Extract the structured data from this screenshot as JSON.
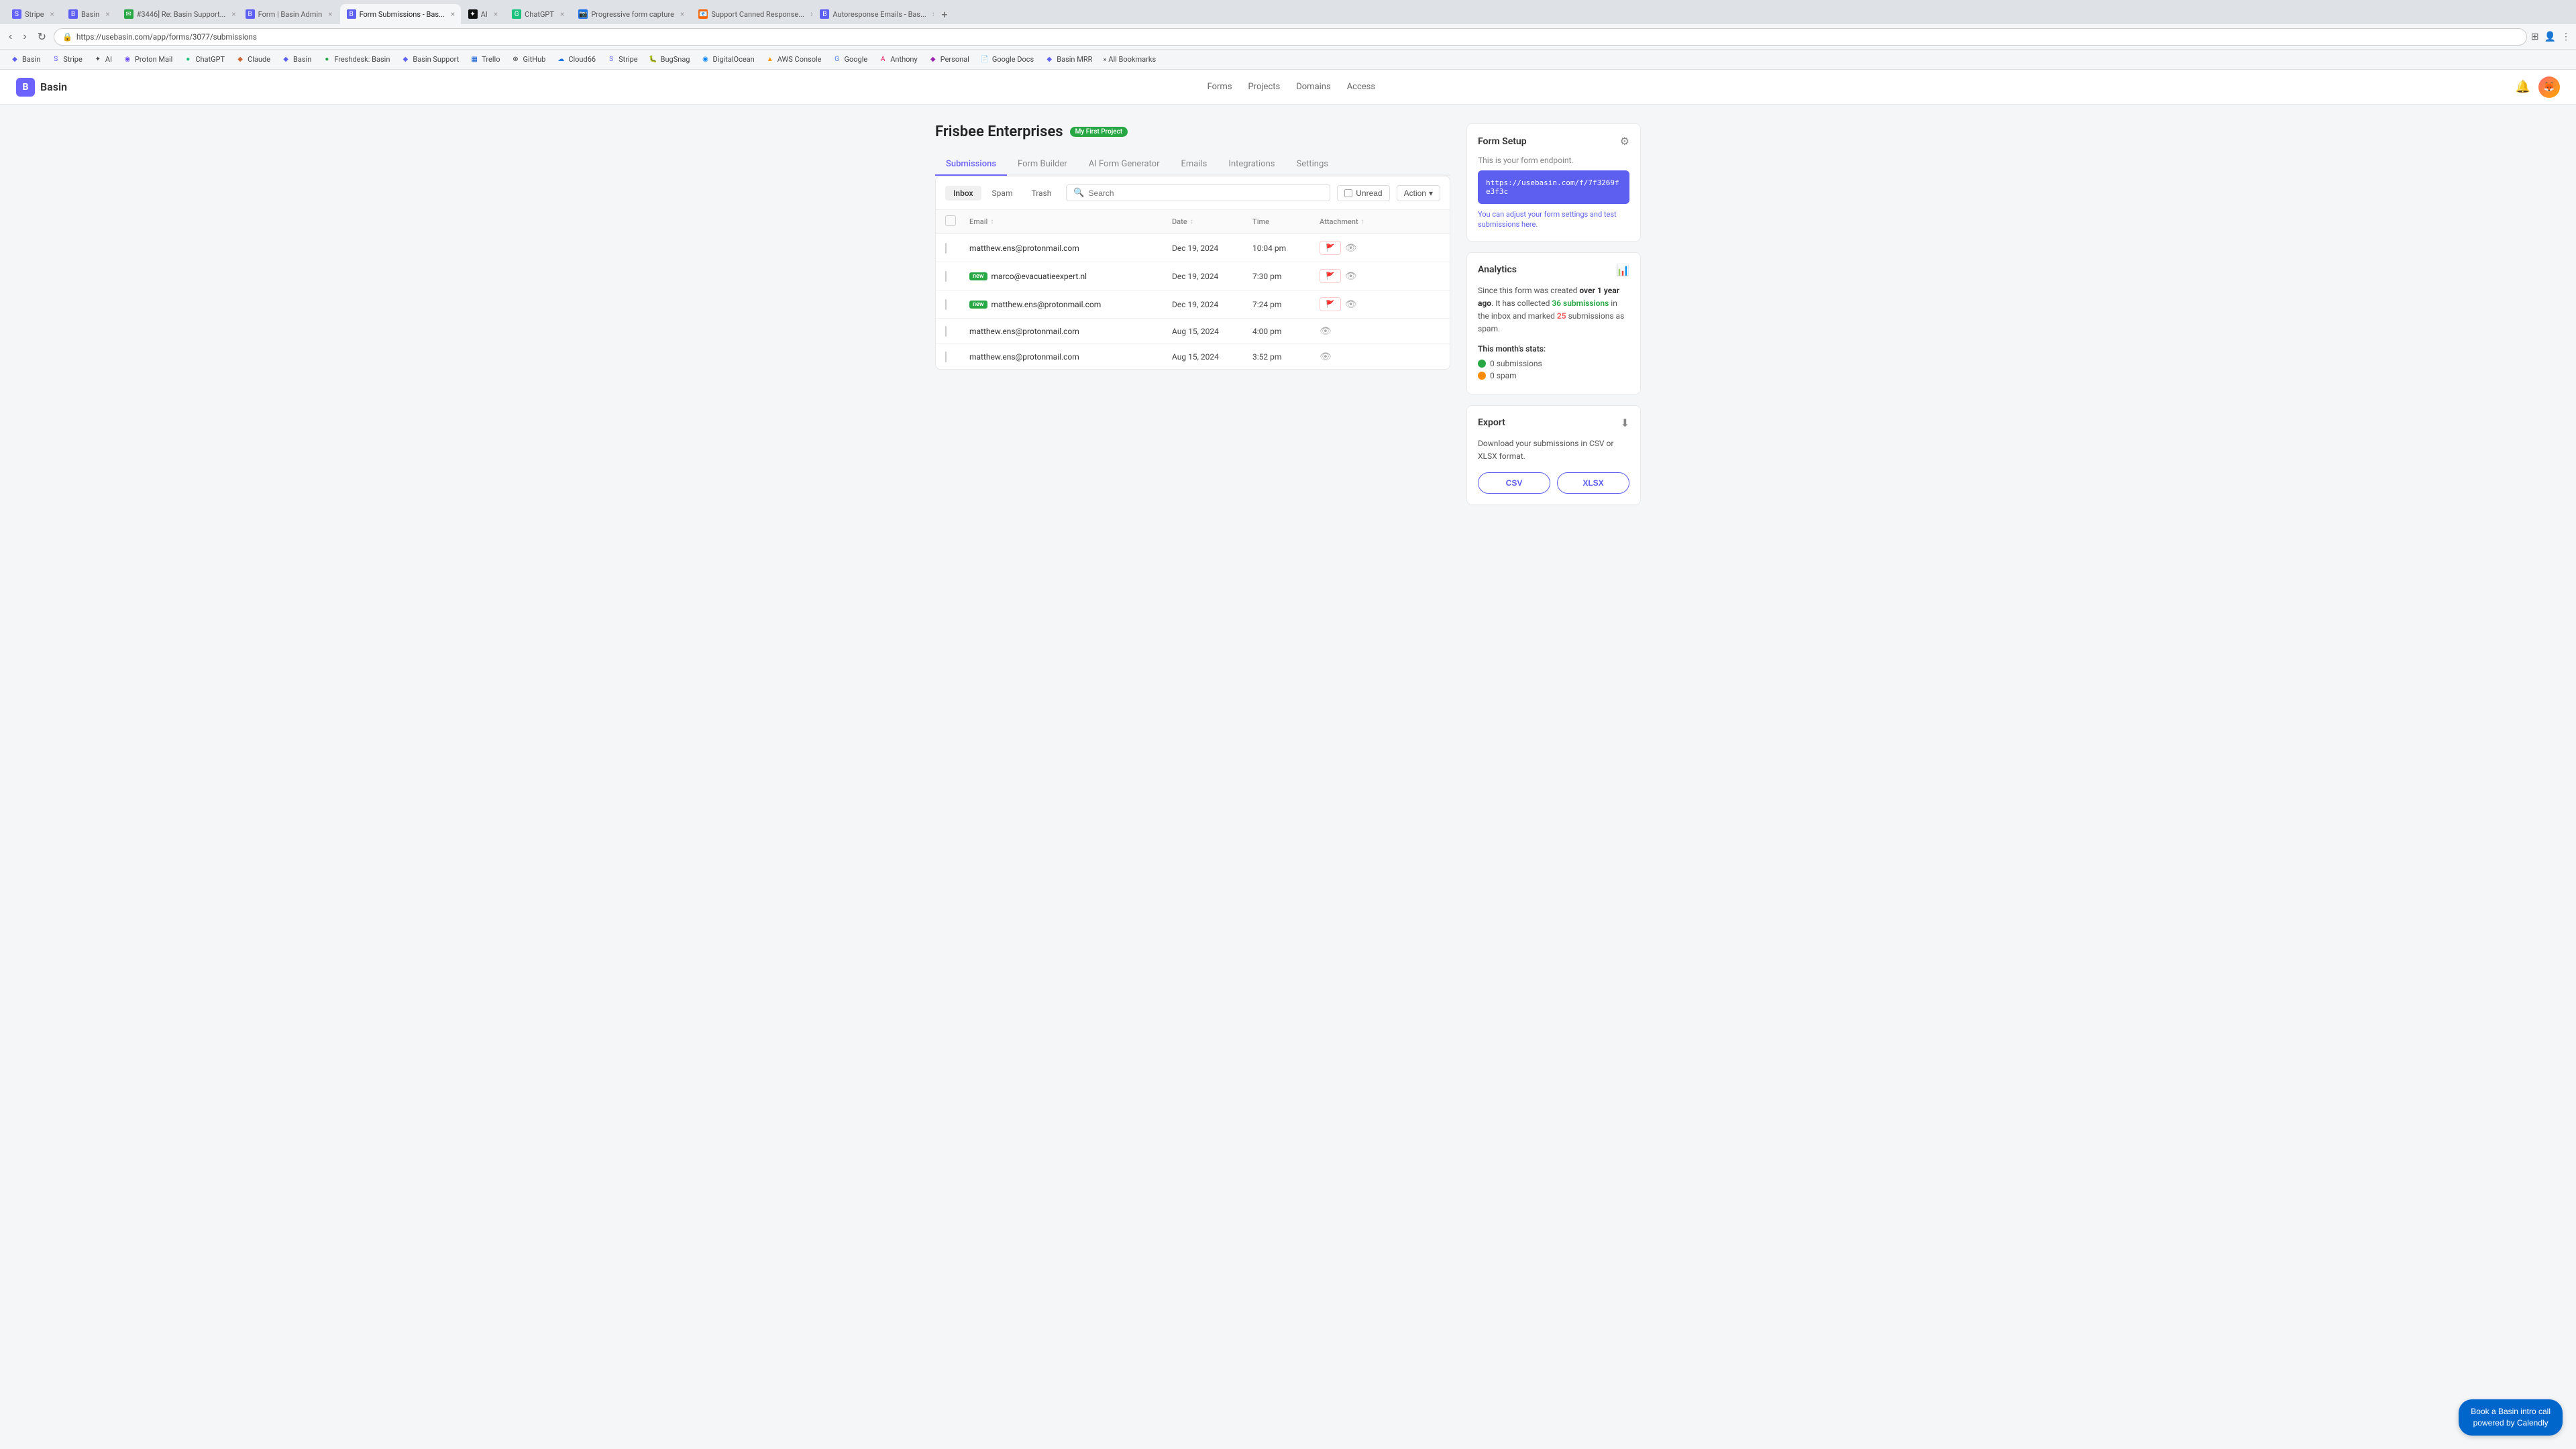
{
  "browser": {
    "tabs": [
      {
        "id": "stripe",
        "label": "Stripe",
        "favicon_color": "#6563ff",
        "favicon_text": "S",
        "active": false
      },
      {
        "id": "basin",
        "label": "Basin",
        "favicon_color": "#5c5fef",
        "favicon_text": "B",
        "active": false
      },
      {
        "id": "support",
        "label": "#3446] Re: Basin Support...",
        "favicon_color": "#28a745",
        "favicon_text": "✉",
        "active": false
      },
      {
        "id": "basin-admin",
        "label": "Form | Basin Admin",
        "favicon_color": "#5c5fef",
        "favicon_text": "B",
        "active": false
      },
      {
        "id": "form-submissions",
        "label": "Form Submissions - Bas...",
        "favicon_color": "#5c5fef",
        "favicon_text": "B",
        "active": true
      },
      {
        "id": "ai",
        "label": "AI",
        "favicon_color": "#111",
        "favicon_text": "✦",
        "active": false
      },
      {
        "id": "chatgpt",
        "label": "ChatGPT",
        "favicon_color": "#19c37d",
        "favicon_text": "G",
        "active": false
      },
      {
        "id": "progressive",
        "label": "Progressive form capture",
        "favicon_color": "#1a73e8",
        "favicon_text": "📷",
        "active": false
      },
      {
        "id": "support-canned",
        "label": "Support Canned Response...",
        "favicon_color": "#ff6600",
        "favicon_text": "📧",
        "active": false
      },
      {
        "id": "autoresponse",
        "label": "Autoresponse Emails - Bas...",
        "favicon_color": "#5c5fef",
        "favicon_text": "B",
        "active": false
      }
    ],
    "url": "https://usebasin.com/app/forms/3077/submissions"
  },
  "bookmarks": [
    {
      "label": "Basin",
      "color": "#5c5fef"
    },
    {
      "label": "Stripe",
      "color": "#6563ff"
    },
    {
      "label": "AI",
      "color": "#111"
    },
    {
      "label": "Proton Mail",
      "color": "#6d4aff"
    },
    {
      "label": "ChatGPT",
      "color": "#19c37d"
    },
    {
      "label": "Claude",
      "color": "#cc6633"
    },
    {
      "label": "Basin",
      "color": "#5c5fef"
    },
    {
      "label": "Freshdesk: Basin",
      "color": "#28a745"
    },
    {
      "label": "Basin Support",
      "color": "#5c5fef"
    },
    {
      "label": "Trello",
      "color": "#0052cc"
    },
    {
      "label": "GitHub",
      "color": "#333"
    },
    {
      "label": "Cloud66",
      "color": "#1a73e8"
    },
    {
      "label": "Stripe",
      "color": "#6563ff"
    },
    {
      "label": "BugSnag",
      "color": "#cc4b37"
    },
    {
      "label": "DigitalOcean",
      "color": "#0080ff"
    },
    {
      "label": "AWS Console",
      "color": "#ff9900"
    },
    {
      "label": "Google",
      "color": "#4285f4"
    },
    {
      "label": "Anthony",
      "color": "#e91e63"
    },
    {
      "label": "Personal",
      "color": "#9c27b0"
    },
    {
      "label": "Google Docs",
      "color": "#4285f4"
    },
    {
      "label": "Basin MRR",
      "color": "#5c5fef"
    },
    {
      "label": "All Bookmarks",
      "color": "#666"
    }
  ],
  "app": {
    "logo_text": "B",
    "title": "Basin",
    "nav_items": [
      "Forms",
      "Projects",
      "Domains",
      "Access"
    ],
    "page_title": "Frisbee Enterprises",
    "first_project_badge": "My First Project",
    "tabs": [
      {
        "id": "submissions",
        "label": "Submissions",
        "active": true
      },
      {
        "id": "form-builder",
        "label": "Form Builder",
        "active": false
      },
      {
        "id": "ai-form",
        "label": "AI Form Generator",
        "active": false
      },
      {
        "id": "emails",
        "label": "Emails",
        "active": false
      },
      {
        "id": "integrations",
        "label": "Integrations",
        "active": false
      },
      {
        "id": "settings",
        "label": "Settings",
        "active": false
      }
    ]
  },
  "submissions": {
    "sub_tabs": [
      {
        "label": "Inbox",
        "active": true
      },
      {
        "label": "Spam",
        "active": false
      },
      {
        "label": "Trash",
        "active": false
      }
    ],
    "search_placeholder": "Search",
    "unread_label": "Unread",
    "action_label": "Action",
    "table_headers": [
      {
        "label": "Email",
        "sortable": true
      },
      {
        "label": "Date",
        "sortable": true
      },
      {
        "label": "Time",
        "sortable": false
      },
      {
        "label": "Attachment",
        "sortable": true
      }
    ],
    "rows": [
      {
        "email": "matthew.ens@protonmail.com",
        "date": "Dec 19, 2024",
        "time": "10:04 pm",
        "has_attachment": true,
        "is_new": false,
        "has_spam_btn": true
      },
      {
        "email": "marco@evacuatieexpert.nl",
        "date": "Dec 19, 2024",
        "time": "7:30 pm",
        "has_attachment": true,
        "is_new": true,
        "has_spam_btn": true
      },
      {
        "email": "matthew.ens@protonmail.com",
        "date": "Dec 19, 2024",
        "time": "7:24 pm",
        "has_attachment": true,
        "is_new": true,
        "has_spam_btn": true
      },
      {
        "email": "matthew.ens@protonmail.com",
        "date": "Aug 15, 2024",
        "time": "4:00 pm",
        "has_attachment": false,
        "is_new": false,
        "has_spam_btn": false
      },
      {
        "email": "matthew.ens@protonmail.com",
        "date": "Aug 15, 2024",
        "time": "3:52 pm",
        "has_attachment": false,
        "is_new": false,
        "has_spam_btn": false
      }
    ]
  },
  "form_setup": {
    "title": "Form Setup",
    "endpoint_label": "This is your form endpoint.",
    "endpoint_url": "https://usebasin.com/f/7f3269fe3f3c",
    "settings_text": "You can adjust your form settings and test submissions here."
  },
  "analytics": {
    "title": "Analytics",
    "description_start": "Since this form was created ",
    "time_ago": "over 1 year ago",
    "description_mid": ". It has collected ",
    "submissions_count": "36 submissions",
    "description_mid2": " in the inbox and marked ",
    "spam_count": "25",
    "description_end": " submissions as spam.",
    "this_month_label": "This month's stats:",
    "monthly_submissions": "0 submissions",
    "monthly_spam": "0 spam"
  },
  "export": {
    "title": "Export",
    "description": "Download your submissions in CSV or XLSX format.",
    "csv_label": "CSV",
    "xlsx_label": "XLSX"
  },
  "calendly": {
    "line1": "Book a Basin intro call",
    "line2": "powered by Calendly"
  }
}
